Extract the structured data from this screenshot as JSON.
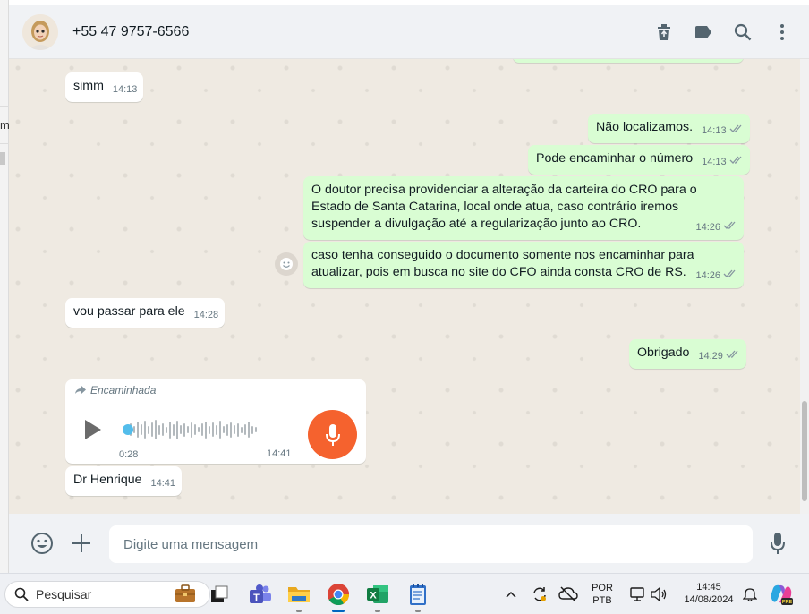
{
  "header": {
    "contact_name": "+55 47 9757-6566",
    "icons": [
      "trash-icon",
      "label-icon",
      "search-icon",
      "menu-dots-icon"
    ]
  },
  "messages": [
    {
      "dir": "in",
      "text": "simm",
      "time": "14:13"
    },
    {
      "dir": "out",
      "text": "Não localizamos.",
      "time": "14:13"
    },
    {
      "dir": "out",
      "text": "Pode encaminhar o número",
      "time": "14:13"
    },
    {
      "dir": "out",
      "text": "O doutor precisa providenciar a alteração da carteira do CRO para o Estado de Santa Catarina, local onde atua, caso contrário iremos suspender a divulgação até a regularização junto ao CRO.",
      "time": "14:26"
    },
    {
      "dir": "out",
      "text": "caso tenha conseguido o documento somente nos encaminhar para atualizar, pois em busca no site do CFO ainda consta CRO de RS.",
      "time": "14:26"
    },
    {
      "dir": "in",
      "text": "vou passar para ele",
      "time": "14:28"
    },
    {
      "dir": "out",
      "text": "Obrigado",
      "time": "14:29"
    },
    {
      "dir": "in",
      "text": "Dr Henrique",
      "time": "14:41"
    }
  ],
  "audio": {
    "forwarded_label": "Encaminhada",
    "duration": "0:28",
    "time": "14:41",
    "progress": 0
  },
  "footer": {
    "placeholder": "Digite uma mensagem"
  },
  "taskbar": {
    "search_label": "Pesquisar",
    "lang_line1": "POR",
    "lang_line2": "PTB",
    "clock_time": "14:45",
    "clock_date": "14/08/2024"
  },
  "colors": {
    "outgoing": "#d9fdd3",
    "incoming": "#ffffff",
    "chat_bg": "#efeae2",
    "mic_button": "#f5622e",
    "read_ticks": "#8696a0"
  }
}
